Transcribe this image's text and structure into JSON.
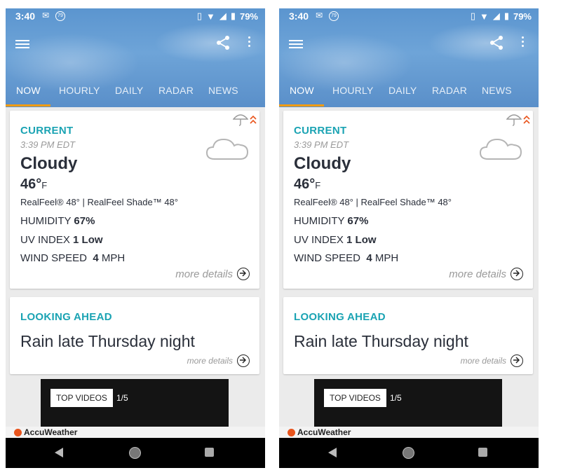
{
  "status": {
    "time": "3:40",
    "notif_count": "79",
    "battery": "79%"
  },
  "tabs": [
    {
      "label": "NOW"
    },
    {
      "label": "HOURLY"
    },
    {
      "label": "DAILY"
    },
    {
      "label": "RADAR"
    },
    {
      "label": "NEWS"
    }
  ],
  "current": {
    "heading": "CURRENT",
    "time": "3:39 PM EDT",
    "condition": "Cloudy",
    "temp": "46°",
    "temp_unit": "F",
    "realfeel": "RealFeel® 48° | RealFeel Shade™ 48°",
    "humidity_label": "HUMIDITY",
    "humidity_value": "67%",
    "uv_label": "UV INDEX",
    "uv_value": "1 Low",
    "wind_label": "WIND SPEED",
    "wind_value": "4",
    "wind_unit": "MPH",
    "more": "more details"
  },
  "ahead": {
    "heading": "LOOKING AHEAD",
    "text": "Rain late Thursday night",
    "more": "more details"
  },
  "video": {
    "label": "TOP VIDEOS",
    "counter": "1/5"
  },
  "brand": "AccuWeather",
  "icons": [
    "menu-icon",
    "share-icon",
    "kebab-icon",
    "umbrella-icon",
    "chevron-up-icon",
    "cloud-icon",
    "arrow-right-circle-icon",
    "back-icon",
    "home-icon",
    "recent-apps-icon"
  ],
  "colors": {
    "accent": "#1aa3b3",
    "tab_indicator": "#f39c12",
    "header": "#5b95cf"
  }
}
